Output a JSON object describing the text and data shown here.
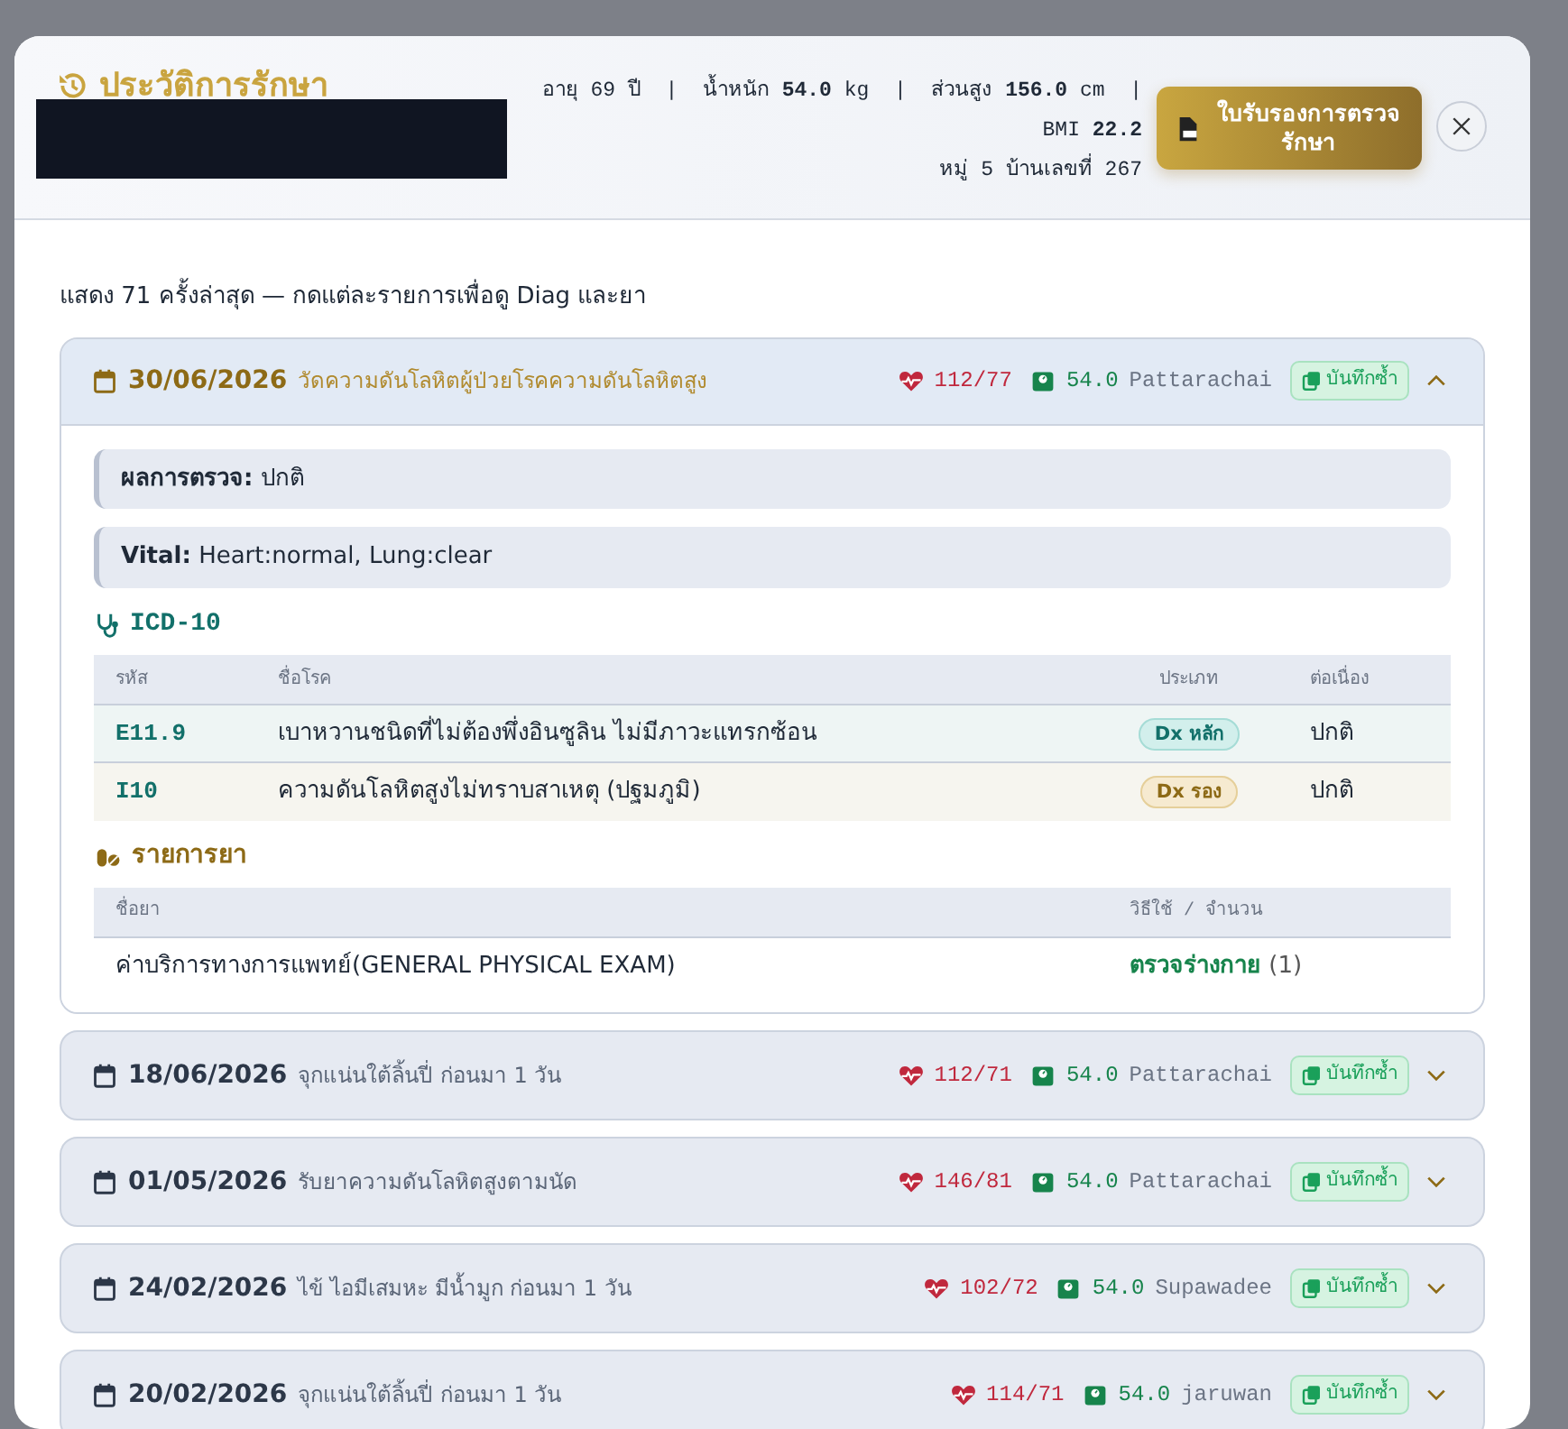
{
  "modal": {
    "title": "ประวัติการรักษา",
    "name_redacted": true,
    "stats": "อายุ 69 ปี  |  น้ำหนัก **54.0** kg  |  ส่วนสูง **156.0** cm  |  BMI **22.2**",
    "address": "หมู่ 5 บ้านเลขที่ 267",
    "certificate_button": "ใบรับรองการตรวจรักษา",
    "summary": "แสดง 71 ครั้งล่าสุด — กดแต่ละรายการเพื่อดู Diag และยา",
    "visits": [
      {
        "date": "30/06/2026",
        "complaint": "วัดความดันโลหิตผู้ป่วยโรคความดันโลหิตสูง",
        "bp": "112/77",
        "weight": "54.0",
        "doctor": "Pattarachai",
        "copy_label": "บันทึกซ้ำ",
        "expanded": true,
        "details": {
          "findings": [
            {
              "label": "ผลการตรวจ:",
              "value": "ปกติ"
            },
            {
              "label": "Vital:",
              "value": "Heart:normal, Lung:clear"
            }
          ],
          "icd": {
            "title": "ICD-10",
            "columns": [
              "รหัส",
              "ชื่อโรค",
              "ประเภท",
              "ต่อเนื่อง"
            ],
            "rows": [
              {
                "code": "E11.9",
                "name": "เบาหวานชนิดที่ไม่ต้องพึ่งอินซูลิน ไม่มีภาวะแทรกซ้อน",
                "type": "Dx หลัก",
                "kind": "primary",
                "status": "ปกติ"
              },
              {
                "code": "I10",
                "name": "ความดันโลหิตสูงไม่ทราบสาเหตุ (ปฐมภูมิ)",
                "type": "Dx รอง",
                "kind": "secondary",
                "status": "ปกติ"
              }
            ]
          },
          "drugs": {
            "title": "รายการยา",
            "columns": [
              "ชื่อยา",
              "วิธีใช้ / จำนวน"
            ],
            "rows": [
              {
                "name": "ค่าบริการทางการแพทย์(GENERAL PHYSICAL EXAM)",
                "usage": "ตรวจร่างกาย",
                "qty": "(1)"
              }
            ]
          }
        }
      },
      {
        "date": "18/06/2026",
        "complaint": "จุกแน่นใต้ลิ้นปี่ ก่อนมา 1 วัน",
        "bp": "112/71",
        "weight": "54.0",
        "doctor": "Pattarachai",
        "copy_label": "บันทึกซ้ำ",
        "expanded": false
      },
      {
        "date": "01/05/2026",
        "complaint": "รับยาความดันโลหิตสูงตามนัด",
        "bp": "146/81",
        "weight": "54.0",
        "doctor": "Pattarachai",
        "copy_label": "บันทึกซ้ำ",
        "expanded": false
      },
      {
        "date": "24/02/2026",
        "complaint": "ไข้ ไอมีเสมหะ มีน้ำมูก ก่อนมา 1 วัน",
        "bp": "102/72",
        "weight": "54.0",
        "doctor": "Supawadee",
        "copy_label": "บันทึกซ้ำ",
        "expanded": false
      },
      {
        "date": "20/02/2026",
        "complaint": "จุกแน่นใต้ลิ้นปี่ ก่อนมา 1 วัน",
        "bp": "114/71",
        "weight": "54.0",
        "doctor": "jaruwan",
        "copy_label": "บันทึกซ้ำ",
        "expanded": false
      }
    ]
  }
}
